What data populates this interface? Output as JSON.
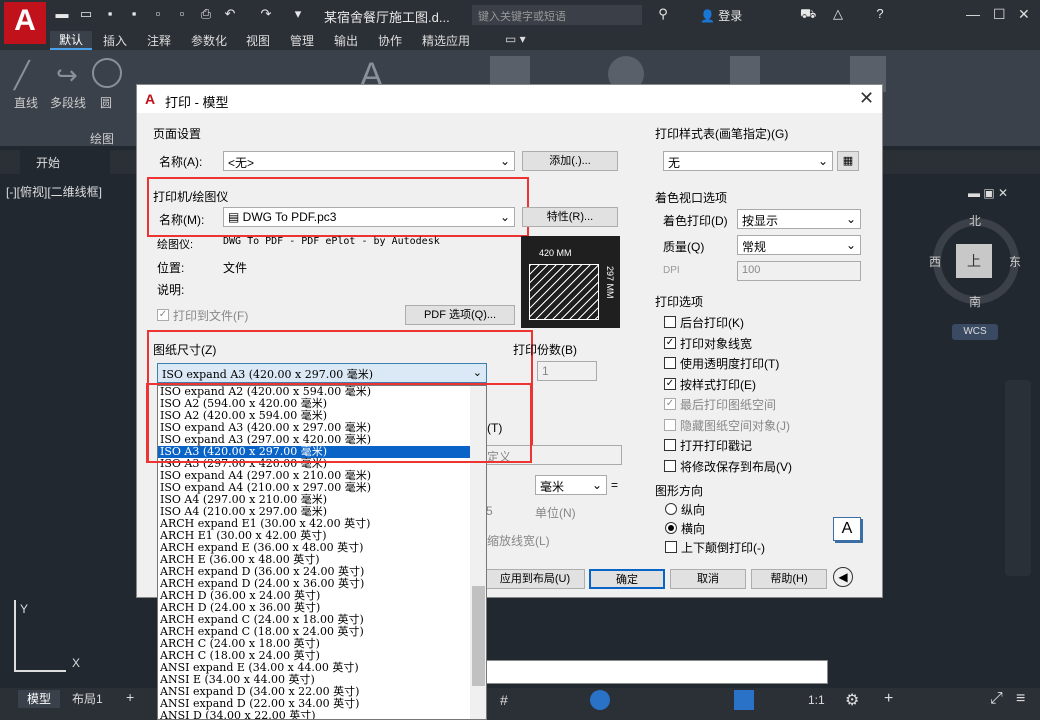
{
  "app": {
    "logo_letter": "A",
    "doc_title": "某宿舍餐厅施工图.d...",
    "search_placeholder": "键入关键字或短语",
    "login": "登录",
    "ribbon_tabs": [
      "默认",
      "插入",
      "注释",
      "参数化",
      "视图",
      "管理",
      "输出",
      "协作",
      "精选应用"
    ],
    "ribbon_tools": [
      "直线",
      "多段线",
      "圆"
    ],
    "panel_label": "绘图",
    "file_tab": "开始",
    "view_label": "[-][俯视][二维线框]",
    "compass": {
      "north": "北",
      "south": "南",
      "east": "东",
      "west": "西",
      "top": "上"
    },
    "wcs": "WCS",
    "model_tab": "模型",
    "layout_tab": "布局1",
    "scale": "1:1"
  },
  "dialog": {
    "title": "打印 - 模型",
    "page_setup": {
      "group": "页面设置",
      "name_label": "名称(A):",
      "name_value": "<无>",
      "add_button": "添加(.)..."
    },
    "printer": {
      "group": "打印机/绘图仪",
      "name_label": "名称(M):",
      "name_value": "DWG To PDF.pc3",
      "props_button": "特性(R)...",
      "plotter_label": "绘图仪:",
      "plotter_value": "DWG To PDF - PDF ePlot - by Autodesk",
      "location_label": "位置:",
      "location_value": "文件",
      "desc_label": "说明:",
      "print_to_file": "打印到文件(F)",
      "pdf_options_button": "PDF 选项(Q)...",
      "preview_w": "420 MM",
      "preview_h": "297 MM"
    },
    "paper_size": {
      "group": "图纸尺寸(Z)",
      "value": "ISO expand A3 (420.00 x 297.00 毫米)"
    },
    "copies": {
      "label": "打印份数(B)",
      "value": "1"
    },
    "dropdown_items": [
      "ISO expand A2 (420.00 x 594.00 毫米)",
      "ISO A2 (594.00 x 420.00 毫米)",
      "ISO A2 (420.00 x 594.00 毫米)",
      "ISO expand A3 (420.00 x 297.00 毫米)",
      "ISO expand A3 (297.00 x 420.00 毫米)",
      "ISO A3 (420.00 x 297.00 毫米)",
      "ISO A3 (297.00 x 420.00 毫米)",
      "ISO expand A4 (297.00 x 210.00 毫米)",
      "ISO expand A4 (210.00 x 297.00 毫米)",
      "ISO A4 (297.00 x 210.00 毫米)",
      "ISO A4 (210.00 x 297.00 毫米)",
      "ARCH expand E1 (30.00 x 42.00 英寸)",
      "ARCH E1 (30.00 x 42.00 英寸)",
      "ARCH expand E (36.00 x 48.00 英寸)",
      "ARCH E (36.00 x 48.00 英寸)",
      "ARCH expand D (36.00 x 24.00 英寸)",
      "ARCH expand D (24.00 x 36.00 英寸)",
      "ARCH D (36.00 x 24.00 英寸)",
      "ARCH D (24.00 x 36.00 英寸)",
      "ARCH expand C (24.00 x 18.00 英寸)",
      "ARCH expand C (18.00 x 24.00 英寸)",
      "ARCH C (24.00 x 18.00 英寸)",
      "ARCH C (18.00 x 24.00 英寸)",
      "ANSI expand E (34.00 x 44.00 英寸)",
      "ANSI E (34.00 x 44.00 英寸)",
      "ANSI expand D (34.00 x 22.00 英寸)",
      "ANSI expand D (22.00 x 34.00 英寸)",
      "ANSI D (34.00 x 22.00 英寸)"
    ],
    "dropdown_selected_index": 5,
    "partial": {
      "t": "(T)",
      "custom": "定义",
      "unit": "毫米",
      "unit_label": "单位(N)",
      "scale_lw": "缩放线宽(L)",
      "val5": "5"
    },
    "plot_style": {
      "group": "打印样式表(画笔指定)(G)",
      "value": "无"
    },
    "shaded": {
      "group": "着色视口选项",
      "shade_label": "着色打印(D)",
      "shade_value": "按显示",
      "quality_label": "质量(Q)",
      "quality_value": "常规",
      "dpi_label": "DPI",
      "dpi_value": "100"
    },
    "options": {
      "group": "打印选项",
      "items": [
        {
          "label": "后台打印(K)",
          "checked": false,
          "enabled": true
        },
        {
          "label": "打印对象线宽",
          "checked": true,
          "enabled": true
        },
        {
          "label": "使用透明度打印(T)",
          "checked": false,
          "enabled": true
        },
        {
          "label": "按样式打印(E)",
          "checked": true,
          "enabled": true
        },
        {
          "label": "最后打印图纸空间",
          "checked": true,
          "enabled": false
        },
        {
          "label": "隐藏图纸空间对象(J)",
          "checked": false,
          "enabled": false
        },
        {
          "label": "打开打印戳记",
          "checked": false,
          "enabled": true
        },
        {
          "label": "将修改保存到布局(V)",
          "checked": false,
          "enabled": true
        }
      ]
    },
    "orientation": {
      "group": "图形方向",
      "portrait": "纵向",
      "landscape": "横向",
      "upside": "上下颠倒打印(-)",
      "letter": "A"
    },
    "buttons": {
      "apply": "应用到布局(U)",
      "ok": "确定",
      "cancel": "取消",
      "help": "帮助(H)"
    }
  }
}
